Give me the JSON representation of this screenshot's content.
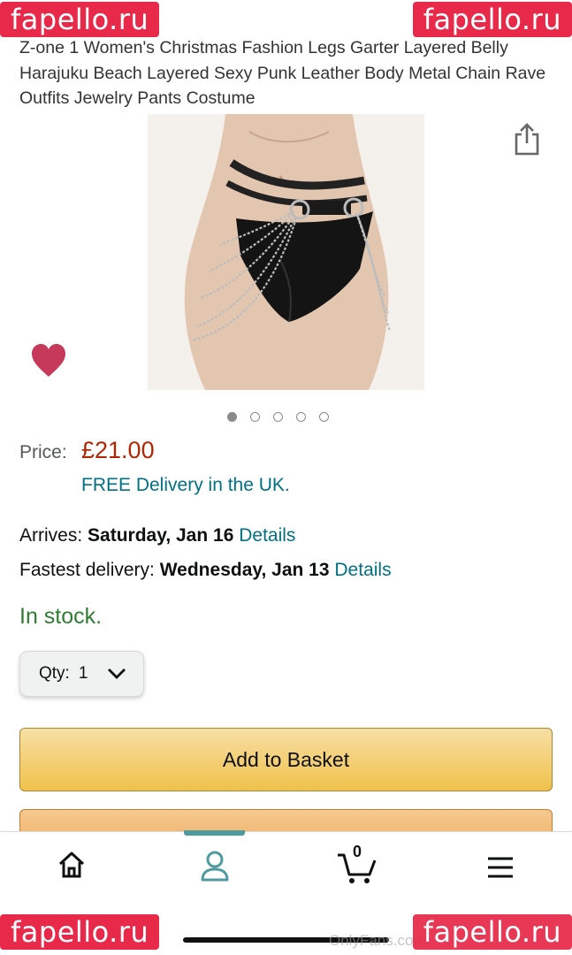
{
  "watermarks": {
    "top_left": "fapello.ru",
    "top_right": "fapello.ru",
    "bottom_left": "fapello.ru",
    "bottom_right": "fapello.ru",
    "onlyfans": "OnlyFans.com"
  },
  "product": {
    "title": "Z-one 1 Women's Christmas Fashion Legs Garter Layered Belly Harajuku Beach Layered Sexy Punk Leather Body Metal Chain Rave Outfits Jewelry Pants Costume",
    "image_count": 5,
    "active_image_index": 0
  },
  "price": {
    "label": "Price:",
    "value": "£21.00",
    "free_delivery": "FREE Delivery in the UK."
  },
  "delivery": {
    "arrives_label": "Arrives:",
    "arrives_date": "Saturday, Jan 16",
    "arrives_link": "Details",
    "fastest_label": "Fastest delivery:",
    "fastest_date": "Wednesday, Jan 13",
    "fastest_link": "Details"
  },
  "stock": {
    "status": "In stock."
  },
  "quantity": {
    "label": "Qty:",
    "value": "1"
  },
  "actions": {
    "add_to_basket": "Add to Basket"
  },
  "nav": {
    "cart_count": "0"
  },
  "colors": {
    "price": "#b12704",
    "link": "#007185",
    "in_stock": "#2f7d32",
    "basket_button": "#f0c14b",
    "buy_button": "#eeb36a",
    "favorite": "#c7395a",
    "watermark": "#e8294a",
    "nav_active": "#4e9aa1"
  },
  "icons": [
    "share-icon",
    "heart-icon",
    "chevron-down-icon",
    "home-icon",
    "account-icon",
    "cart-icon",
    "menu-icon"
  ]
}
